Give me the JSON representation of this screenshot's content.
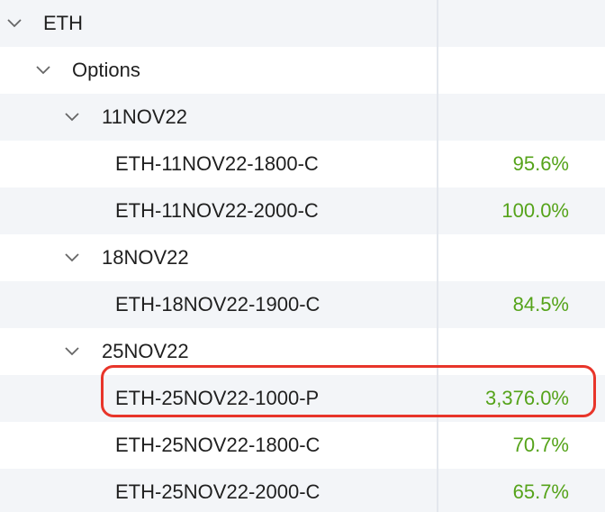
{
  "tree": {
    "root": {
      "label": "ETH"
    },
    "group": {
      "label": "Options"
    },
    "expiries": [
      {
        "label": "11NOV22"
      },
      {
        "label": "18NOV22"
      },
      {
        "label": "25NOV22"
      }
    ],
    "instruments": [
      {
        "name": "ETH-11NOV22-1800-C",
        "value": "95.6%"
      },
      {
        "name": "ETH-11NOV22-2000-C",
        "value": "100.0%"
      },
      {
        "name": "ETH-18NOV22-1900-C",
        "value": "84.5%"
      },
      {
        "name": "ETH-25NOV22-1000-P",
        "value": "3,376.0%"
      },
      {
        "name": "ETH-25NOV22-1800-C",
        "value": "70.7%"
      },
      {
        "name": "ETH-25NOV22-2000-C",
        "value": "65.7%"
      }
    ]
  },
  "colors": {
    "value_green": "#55a31a",
    "alt_row": "#f3f5f8",
    "highlight_red": "#e8352a"
  }
}
